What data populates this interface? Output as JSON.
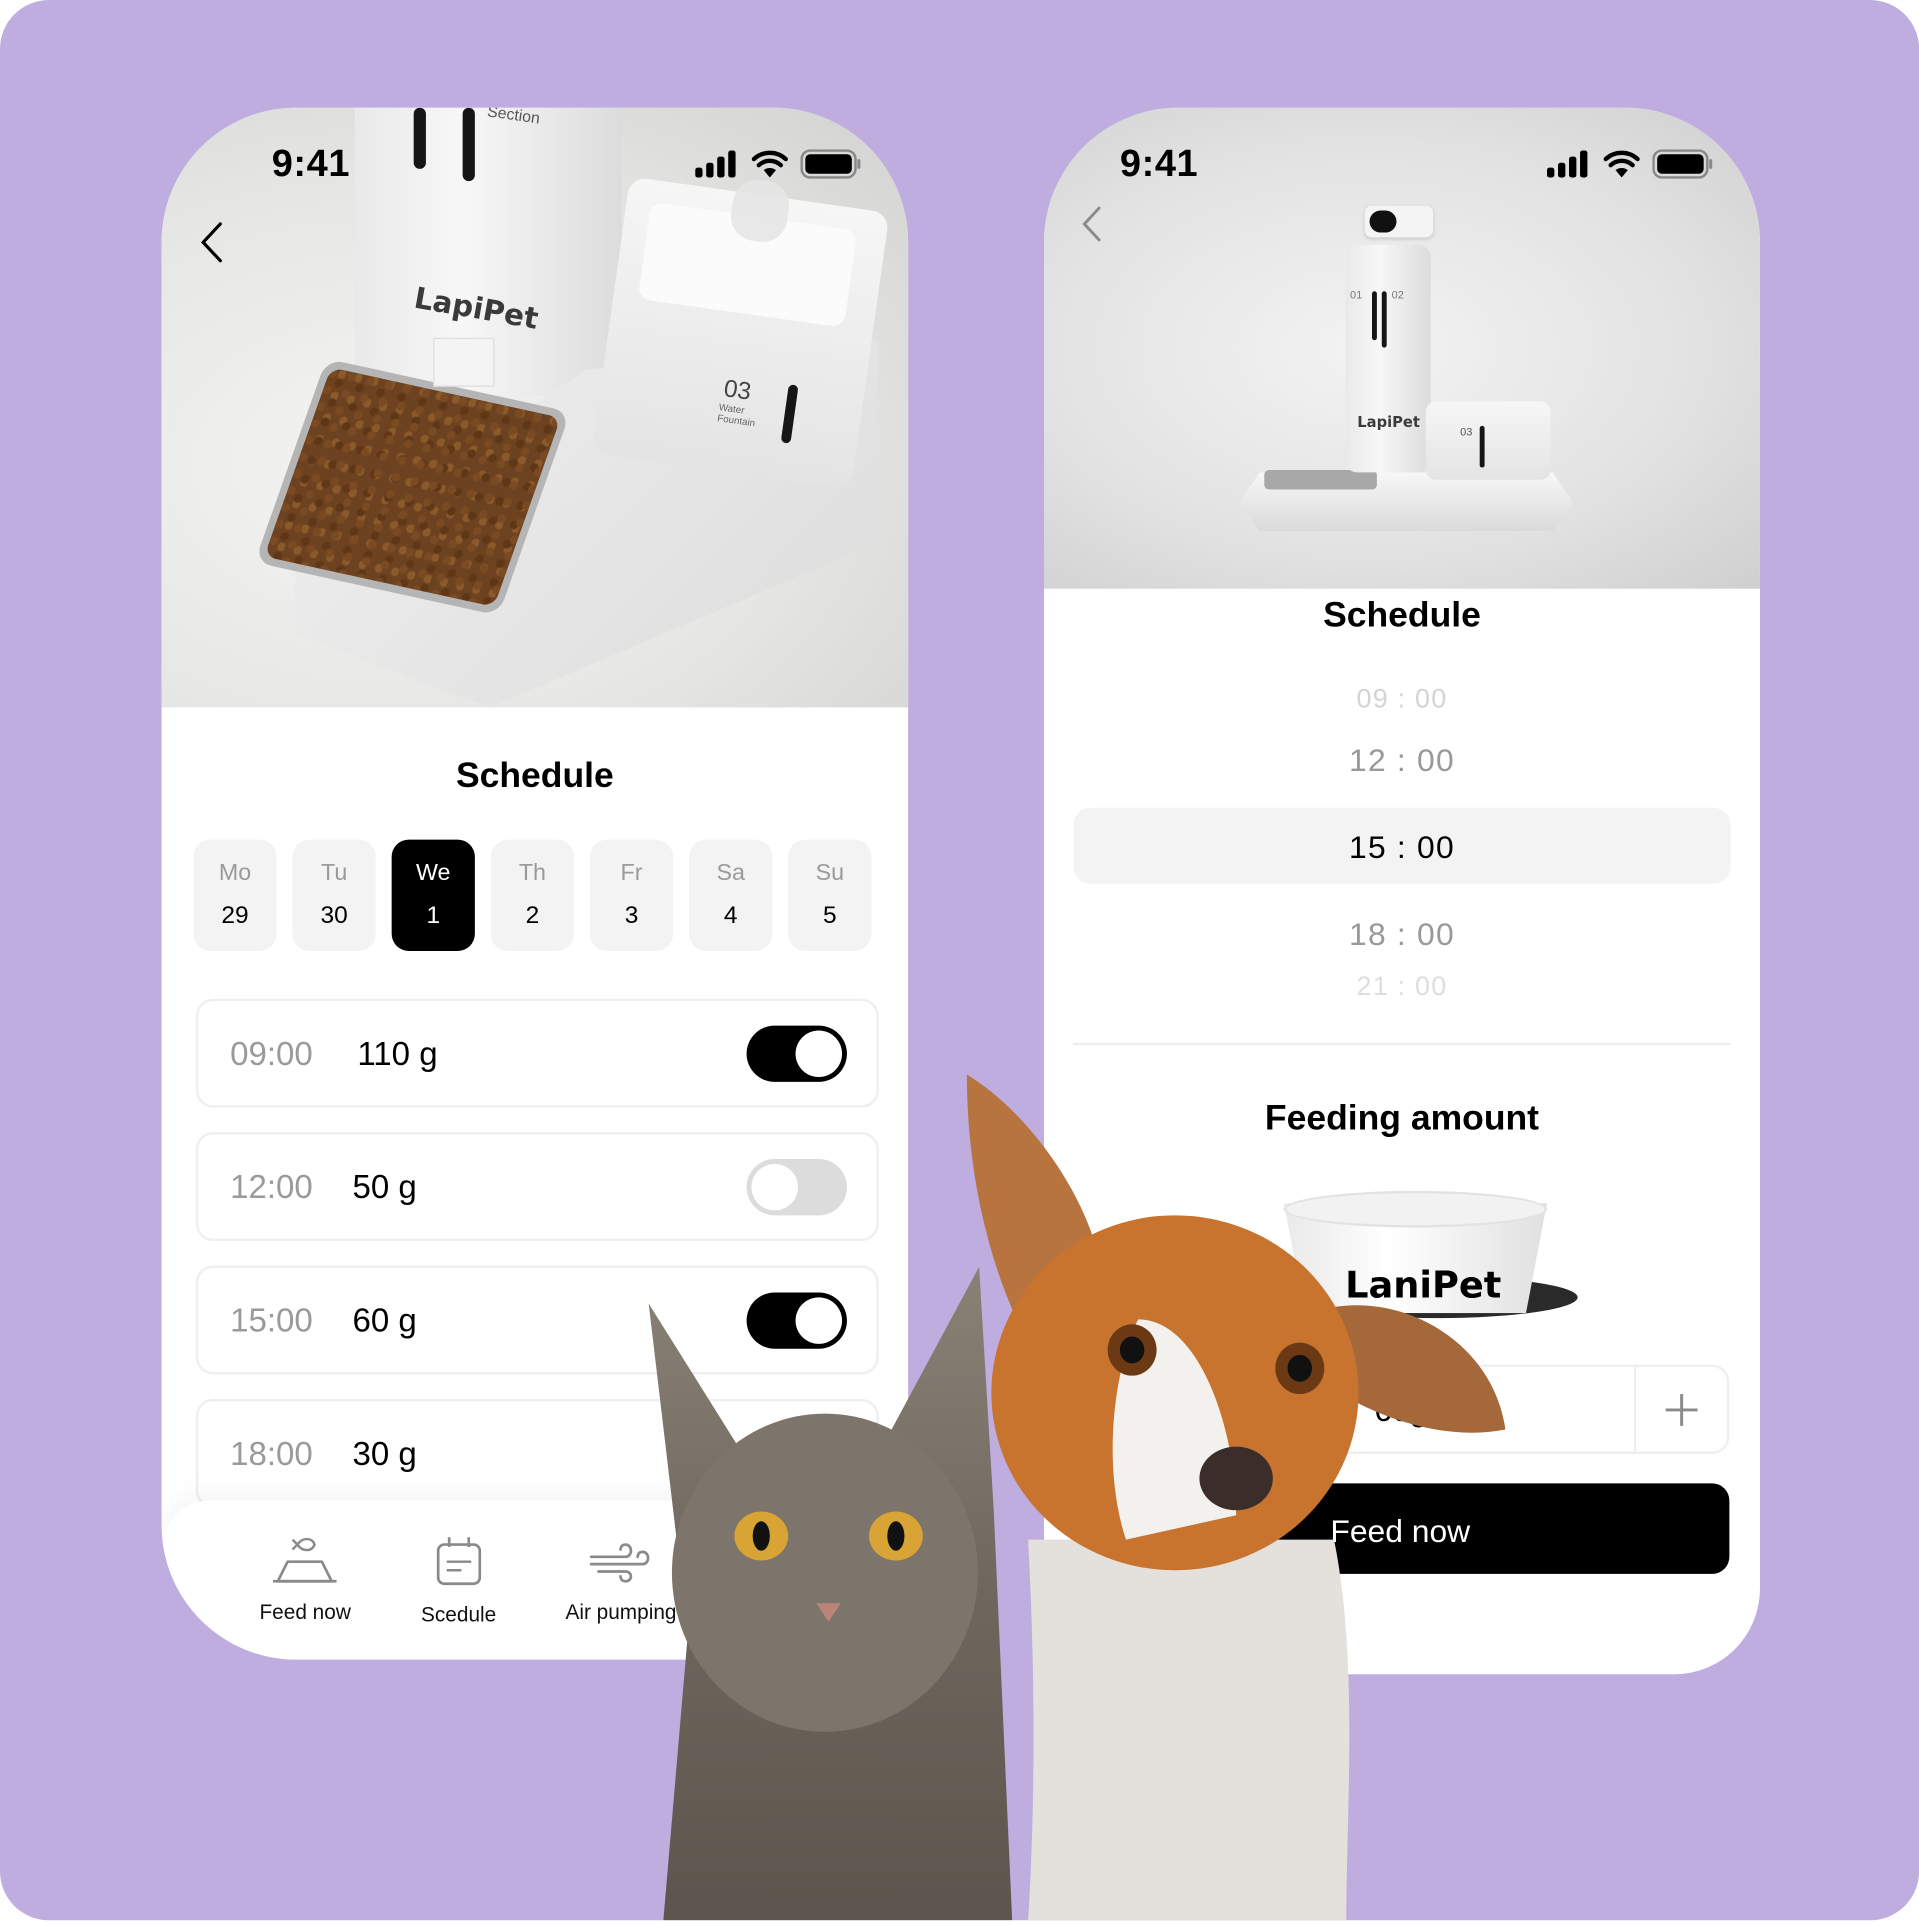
{
  "colors": {
    "background": "#BFADE0",
    "accent": "#000000",
    "muted_text": "#9A9A9A",
    "chip_bg": "#F3F3F3",
    "toggle_off": "#DCDCDC"
  },
  "left_screen": {
    "status_bar": {
      "time": "9:41",
      "icons": [
        "signal-icon",
        "wifi-icon",
        "battery-icon"
      ]
    },
    "hero": {
      "brand": "LapiPet",
      "fountain_label": "03",
      "fountain_sub": "Water Fountain",
      "tower_label": "Section"
    },
    "title": "Schedule",
    "days": [
      {
        "name": "Mo",
        "date": "29",
        "selected": false
      },
      {
        "name": "Tu",
        "date": "30",
        "selected": false
      },
      {
        "name": "We",
        "date": "1",
        "selected": true
      },
      {
        "name": "Th",
        "date": "2",
        "selected": false
      },
      {
        "name": "Fr",
        "date": "3",
        "selected": false
      },
      {
        "name": "Sa",
        "date": "4",
        "selected": false
      },
      {
        "name": "Su",
        "date": "5",
        "selected": false
      }
    ],
    "schedule": [
      {
        "time": "09:00",
        "amount": "110 g",
        "enabled": true
      },
      {
        "time": "12:00",
        "amount": "50 g",
        "enabled": false
      },
      {
        "time": "15:00",
        "amount": "60 g",
        "enabled": true
      },
      {
        "time": "18:00",
        "amount": "30 g",
        "enabled": null
      }
    ],
    "tab_bar": [
      {
        "label": "Feed now",
        "icon": "feed-bowl-icon"
      },
      {
        "label": "Scedule",
        "icon": "calendar-icon"
      },
      {
        "label": "Air pumping",
        "icon": "wind-icon"
      }
    ]
  },
  "right_screen": {
    "status_bar": {
      "time": "9:41",
      "icons": [
        "signal-icon",
        "wifi-icon",
        "battery-icon"
      ]
    },
    "hero": {
      "brand": "LapiPet",
      "labels": [
        "01",
        "02",
        "03"
      ]
    },
    "title": "Schedule",
    "time_picker": {
      "options": [
        "09 : 00",
        "12 : 00",
        "15 : 00",
        "18 : 00",
        "21 : 00"
      ],
      "selected": "15 : 00"
    },
    "feeding_amount_title": "Feeding amount",
    "bowl_brand": "LaniPet",
    "amount_value": "60g",
    "feed_button": "Feed now"
  }
}
